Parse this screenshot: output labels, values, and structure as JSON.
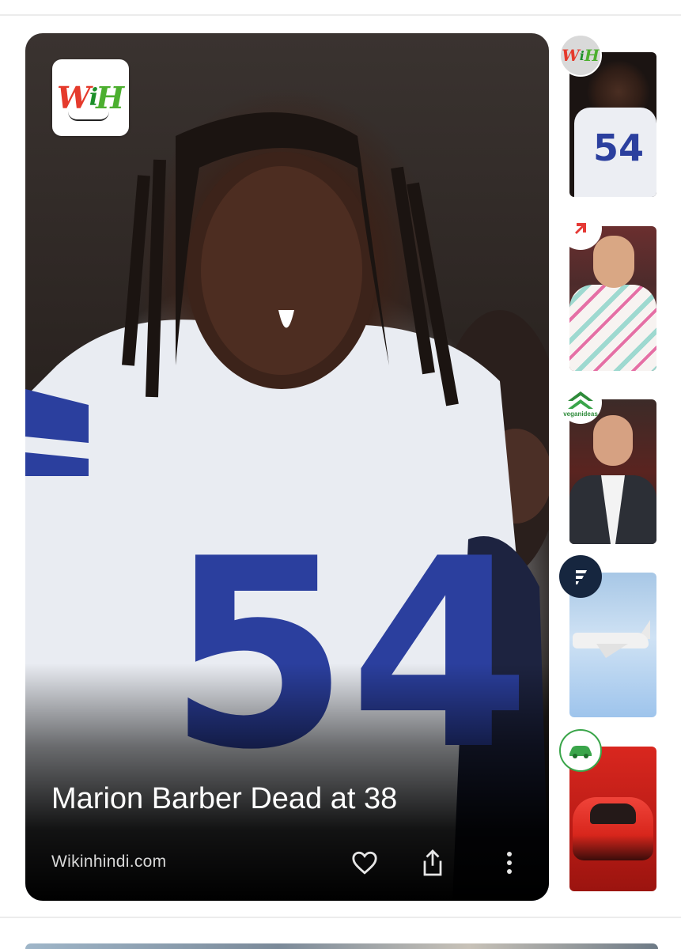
{
  "story": {
    "headline": "Marion Barber Dead at 38",
    "source": "Wikinhindi.com",
    "jersey_number": "54",
    "publisher_logo": {
      "letter_w": "W",
      "letter_i": "i",
      "letter_h": "H"
    }
  },
  "actions": [
    {
      "name": "like",
      "icon": "heart-outline-icon"
    },
    {
      "name": "share",
      "icon": "share-icon"
    },
    {
      "name": "more",
      "icon": "more-vertical-icon"
    }
  ],
  "rail": {
    "items": [
      {
        "badge": "wih-logo",
        "jersey_number": "54"
      },
      {
        "badge": "red-chevron-logo"
      },
      {
        "badge": "veganideas-logo",
        "badge_text": "veganideas"
      },
      {
        "badge": "navy-f-logo"
      },
      {
        "badge": "green-car-logo"
      }
    ]
  },
  "colors": {
    "card_bg": "#000000",
    "headline": "#ffffff",
    "source": "#d8d8d8",
    "jersey_blue": "#2b3f9e",
    "logo_red": "#e53a2c",
    "logo_green": "#4caf2f"
  }
}
